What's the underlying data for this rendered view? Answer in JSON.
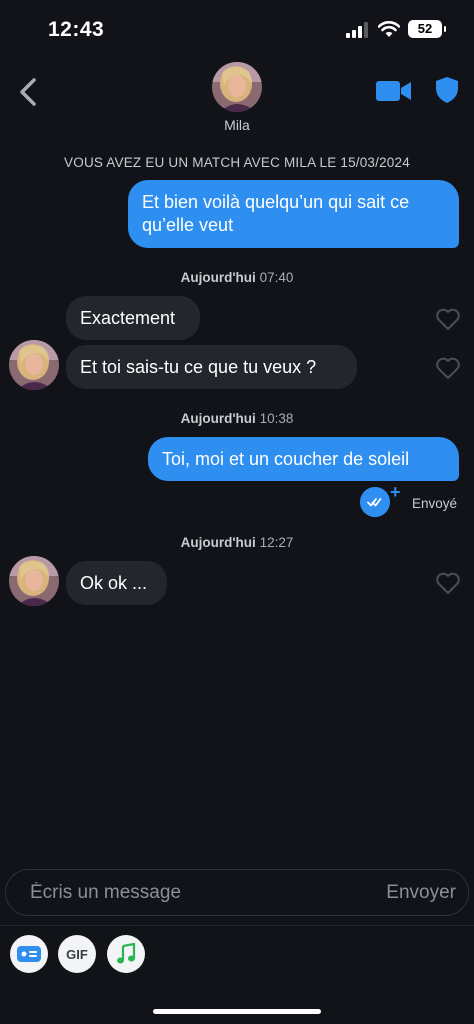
{
  "status_bar": {
    "time": "12:43",
    "battery": "52"
  },
  "header": {
    "contact_name": "Mila"
  },
  "chat": {
    "match_banner": "VOUS AVEZ EU UN MATCH AVEC MILA LE 15/03/2024",
    "messages": [
      {
        "text": "Et bien voilà quelqu’un qui sait ce qu’elle veut"
      },
      {
        "day": "Aujourd'hui",
        "time": "07:40"
      },
      {
        "text": "Exactement"
      },
      {
        "text": "Et toi sais-tu ce que tu veux ?"
      },
      {
        "day": "Aujourd'hui",
        "time": "10:38"
      },
      {
        "text": "Toi, moi et un coucher de soleil",
        "status": "Envoyé"
      },
      {
        "day": "Aujourd'hui",
        "time": "12:27"
      },
      {
        "text": "Ok ok ..."
      }
    ]
  },
  "composer": {
    "placeholder": "Écris un message",
    "send_label": "Envoyer"
  },
  "toolbar": {
    "gif_label": "GIF"
  },
  "colors": {
    "accent": "#2e8ff0",
    "background": "#111318",
    "incoming_bubble": "#23262d"
  }
}
